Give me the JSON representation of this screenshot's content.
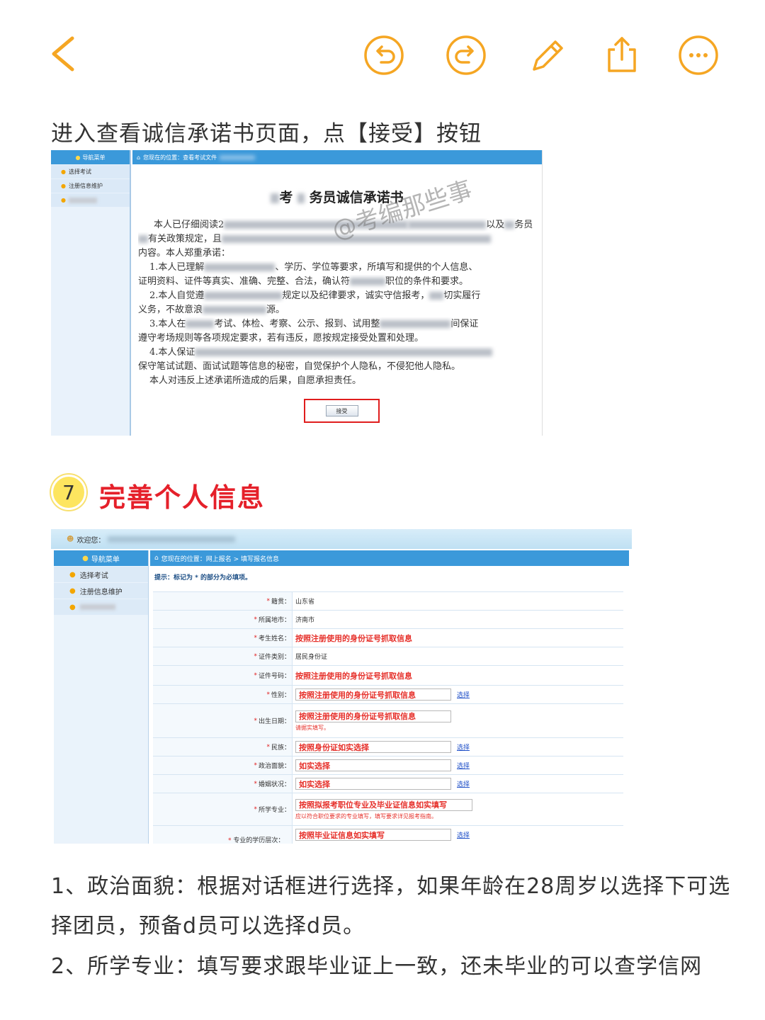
{
  "colors": {
    "accent_orange": "#f5a623",
    "heading_red": "#e5202a",
    "nav_blue": "#3b99da",
    "highlight_red_box": "#e01d1d",
    "underline_orange": "#f6a86b"
  },
  "toolbar": {
    "icons": [
      "chevron-left-icon",
      "undo-icon",
      "redo-icon",
      "pencil-icon",
      "share-icon",
      "more-icon"
    ]
  },
  "intro_text": "进入查看诚信承诺书页面，点【接受】按钮",
  "screenshot1": {
    "nav_header": "导航菜单",
    "nav_items": [
      "选择考试",
      "注册信息维护"
    ],
    "breadcrumb": "您现在的位置：查看考试文件",
    "title_prefix": "考",
    "title_main": "务员诚信承诺书",
    "lines": [
      "本人已仔细阅读2",
      "以及",
      "务员",
      "有关政策规定，且",
      "内容。本人郑重承诺：",
      "1.本人已理解",
      "、学历、学位等要求，所填写和提供的个人信息、",
      "证明资料、证件等真实、准确、完整、合法，确认符",
      "职位的条件和要求。",
      "2.本人自觉遵",
      "规定以及纪律要求，诚实守信报考，",
      "切实履行",
      "义务，不故意浪",
      "源。",
      "3.本人在",
      "考试、体检、考察、公示、报到、试用整",
      "间保证",
      "遵守考场规则等各项规定要求，若有违反，愿按规定接受处置和处理。",
      "4.本人保证",
      "保守笔试试题、面试试题等信息的秘密，自觉保护个人隐私，不侵犯他人隐私。",
      "本人对违反上述承诺所造成的后果，自愿承担责任。"
    ],
    "watermark": "@考编那些事",
    "accept_button": "接受"
  },
  "section": {
    "number": "7",
    "title": "完善个人信息"
  },
  "screenshot2": {
    "welcome": "欢迎您：",
    "nav_header": "导航菜单",
    "nav_items": [
      "选择考试",
      "注册信息维护"
    ],
    "breadcrumb": "您现在的位置：网上报名 > 填写报名信息",
    "hint": "提示：标记为 * 的部分为必填项。",
    "fields": {
      "province_label": "籍贯",
      "province_value": "山东省",
      "city_label": "所属地市",
      "city_value": "济南市",
      "name_label": "考生姓名",
      "name_value": "按照注册使用的身份证号抓取信息",
      "idtype_label": "证件类别",
      "idtype_value": "居民身份证",
      "idno_label": "证件号码",
      "idno_value": "按照注册使用的身份证号抓取信息",
      "gender_label": "性别",
      "gender_value": "按照注册使用的身份证号抓取信息",
      "birth_label": "出生日期",
      "birth_value": "按照注册使用的身份证号抓取信息",
      "birth_note": "请据实填写。",
      "ethnic_label": "民族",
      "ethnic_value": "按照身份证如实选择",
      "political_label": "政治面貌",
      "political_value": "如实选择",
      "marital_label": "婚姻状况",
      "marital_value": "如实选择",
      "major_label": "所学专业",
      "major_value": "按照拟报考职位专业及毕业证信息如实填写",
      "major_note": "应以符合职位要求的专业填写，填写要求详见报考指南。",
      "edu_value": "按照毕业证信息如实填写",
      "edu_label": "专业的学历层次",
      "select_link": "选择"
    }
  },
  "notes": {
    "n1_num": "1、",
    "n1_key": "政治面貌：",
    "n1_text": "根据对话框进行选择，如果年龄在28周岁以选择下可选",
    "n1_cont": "择团员，预备d员可以选择d员。",
    "n2_num": "2、",
    "n2_key": "所学专业：",
    "n2_text": "填写要求跟毕业证上一致，还未毕业的可以查学信网"
  }
}
